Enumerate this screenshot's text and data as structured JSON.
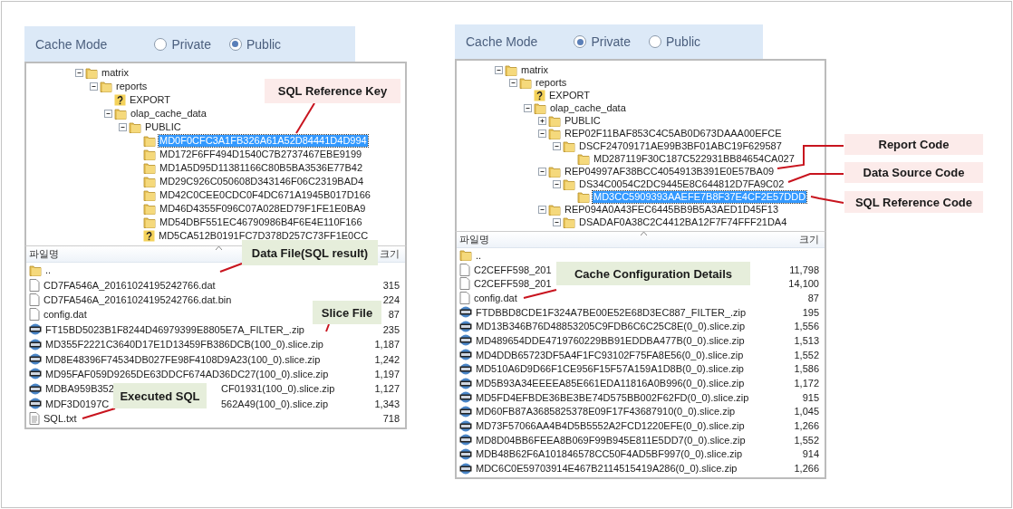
{
  "left_panel": {
    "cache_mode": {
      "label": "Cache Mode",
      "options": [
        {
          "label": "Private",
          "selected": false
        },
        {
          "label": "Public",
          "selected": true
        }
      ]
    },
    "tree": [
      {
        "label": "matrix",
        "kind": "folder",
        "expanded": true,
        "selected": false,
        "children": [
          {
            "label": "reports",
            "kind": "folder",
            "expanded": true,
            "selected": false,
            "children": [
              {
                "label": "EXPORT",
                "kind": "unknown",
                "selected": false
              },
              {
                "label": "olap_cache_data",
                "kind": "folder",
                "expanded": true,
                "selected": false,
                "children": [
                  {
                    "label": "PUBLIC",
                    "kind": "folder",
                    "expanded": true,
                    "selected": false,
                    "children": [
                      {
                        "label": "MD0F0CFC3A1FB326A61A52D84441D4D994",
                        "kind": "folder",
                        "selected": true
                      },
                      {
                        "label": "MD172F6FF494D1540C7B2737467EBE9199",
                        "kind": "folder",
                        "selected": false
                      },
                      {
                        "label": "MD1A5D95D11381166C80B5BA3536E77B42",
                        "kind": "folder",
                        "selected": false
                      },
                      {
                        "label": "MD29C926C050608D343146F06C2319BAD4",
                        "kind": "folder",
                        "selected": false
                      },
                      {
                        "label": "MD42C0CEE0CDC0F4DC671A1945B017D166",
                        "kind": "folder",
                        "selected": false
                      },
                      {
                        "label": "MD46D4355F096C07A028ED79F1FE1E0BA9",
                        "kind": "folder",
                        "selected": false
                      },
                      {
                        "label": "MD54DBF551EC46790986B4F6E4E110F166",
                        "kind": "folder",
                        "selected": false
                      },
                      {
                        "label": "MD5CA512B0191FC7D378D257C73FF1E0CC",
                        "kind": "unknown",
                        "selected": false
                      }
                    ]
                  }
                ]
              }
            ]
          }
        ]
      }
    ],
    "file_list": {
      "columns": [
        "파일명",
        "크기"
      ],
      "rows": [
        {
          "name": "..",
          "kind": "folder"
        },
        {
          "name": "CD7FA546A_20161024195242766.dat",
          "kind": "file",
          "size": "315"
        },
        {
          "name": "CD7FA546A_20161024195242766.dat.bin",
          "kind": "file",
          "size": "224"
        },
        {
          "name": "config.dat",
          "kind": "file",
          "size": "87"
        },
        {
          "name": "FT15BD5023B1F8244D46979399E8805E7A_FILTER_.zip",
          "kind": "zip",
          "size": "235"
        },
        {
          "name": "MD355F2221C3640D17E1D13459FB386DCB(100_0).slice.zip",
          "kind": "zip",
          "size": "1,187"
        },
        {
          "name": "MD8E48396F74534DB027FE98F4108D9A23(100_0).slice.zip",
          "kind": "zip",
          "size": "1,242"
        },
        {
          "name": "MD95FAF059D9265DE63DDCF674AD36DC27(100_0).slice.zip",
          "kind": "zip",
          "size": "1,197"
        },
        {
          "name": "MDBA959B352",
          "tail": "CF01931(100_0).slice.zip",
          "kind": "zip",
          "size": "1,127"
        },
        {
          "name": "MDF3D0197C",
          "tail": "562A49(100_0).slice.zip",
          "kind": "zip",
          "size": "1,343"
        },
        {
          "name": "SQL.txt",
          "kind": "text",
          "size": "718"
        }
      ]
    },
    "callouts": [
      {
        "text": "SQL Reference Key",
        "color": "#fcebea"
      },
      {
        "text": "Data File(SQL result)",
        "color": "#e6eedb"
      },
      {
        "text": "Slice File",
        "color": "#e6eedb"
      },
      {
        "text": "Executed SQL",
        "color": "#e6eedb"
      }
    ]
  },
  "right_panel": {
    "cache_mode": {
      "label": "Cache Mode",
      "options": [
        {
          "label": "Private",
          "selected": true
        },
        {
          "label": "Public",
          "selected": false
        }
      ]
    },
    "tree": [
      {
        "label": "matrix",
        "kind": "folder",
        "expanded": true,
        "selected": false,
        "children": [
          {
            "label": "reports",
            "kind": "folder",
            "expanded": true,
            "selected": false,
            "children": [
              {
                "label": "EXPORT",
                "kind": "unknown",
                "selected": false
              },
              {
                "label": "olap_cache_data",
                "kind": "folder",
                "expanded": true,
                "selected": false,
                "children": [
                  {
                    "label": "PUBLIC",
                    "kind": "folder",
                    "expanded": false,
                    "selected": false
                  },
                  {
                    "label": "REP02F11BAF853C4C5AB0D673DAAA00EFCE",
                    "kind": "folder",
                    "expanded": true,
                    "selected": false,
                    "children": [
                      {
                        "label": "DSCF24709171AE99B3BF01ABC19F629587",
                        "kind": "folder",
                        "expanded": true,
                        "selected": false,
                        "children": [
                          {
                            "label": "MD287119F30C187C522931BB84654CA027",
                            "kind": "folder",
                            "selected": false
                          }
                        ]
                      }
                    ]
                  },
                  {
                    "label": "REP04997AF38BCC4054913B391E0E57BA09",
                    "kind": "folder",
                    "expanded": true,
                    "selected": false,
                    "children": [
                      {
                        "label": "DS34C0054C2DC9445E8C644812D7FA9C02",
                        "kind": "folder",
                        "expanded": true,
                        "selected": false,
                        "children": [
                          {
                            "label": "MD3CC5909393AAEFE7B8F37E4CF2E57DDD",
                            "kind": "folder",
                            "selected": true
                          }
                        ]
                      }
                    ]
                  },
                  {
                    "label": "REP094A0A43FEC6445BB9B5A3AED1D45F13",
                    "kind": "folder",
                    "expanded": true,
                    "selected": false,
                    "children": [
                      {
                        "label": "DSADAF0A38C2C4412BA12F7F74FFF21DA4",
                        "kind": "folder",
                        "expanded": true,
                        "selected": false
                      }
                    ]
                  }
                ]
              }
            ]
          }
        ]
      }
    ],
    "file_list": {
      "columns": [
        "파일명",
        "크기"
      ],
      "rows": [
        {
          "name": "..",
          "kind": "folder"
        },
        {
          "name": "C2CEFF598_201",
          "kind": "file",
          "size": "11,798"
        },
        {
          "name": "C2CEFF598_201",
          "kind": "file",
          "size": "14,100"
        },
        {
          "name": "config.dat",
          "kind": "file",
          "size": "87"
        },
        {
          "name": "FTDBBD8CDE1F324A7BE00E52E68D3EC887_FILTER_.zip",
          "kind": "zip",
          "size": "195"
        },
        {
          "name": "MD13B346B76D48853205C9FDB6C6C25C8E(0_0).slice.zip",
          "kind": "zip",
          "size": "1,556"
        },
        {
          "name": "MD489654DDE4719760229BB91EDDBA477B(0_0).slice.zip",
          "kind": "zip",
          "size": "1,513"
        },
        {
          "name": "MD4DDB65723DF5A4F1FC93102F75FA8E56(0_0).slice.zip",
          "kind": "zip",
          "size": "1,552"
        },
        {
          "name": "MD510A6D9D66F1CE956F15F57A159A1D8B(0_0).slice.zip",
          "kind": "zip",
          "size": "1,586"
        },
        {
          "name": "MD5B93A34EEEEA85E661EDA11816A0B996(0_0).slice.zip",
          "kind": "zip",
          "size": "1,172"
        },
        {
          "name": "MD5FD4EFBDE36BE3BE74D575BB002F62FD(0_0).slice.zip",
          "kind": "zip",
          "size": "915"
        },
        {
          "name": "MD60FB87A3685825378E09F17F43687910(0_0).slice.zip",
          "kind": "zip",
          "size": "1,045"
        },
        {
          "name": "MD73F57066AA4B4D5B5552A2FCD1220EFE(0_0).slice.zip",
          "kind": "zip",
          "size": "1,266"
        },
        {
          "name": "MD8D04BB6FEEA8B069F99B945E811E5DD7(0_0).slice.zip",
          "kind": "zip",
          "size": "1,552"
        },
        {
          "name": "MDB48B62F6A101846578CC50F4AD5BF997(0_0).slice.zip",
          "kind": "zip",
          "size": "914"
        },
        {
          "name": "MDC6C0E59703914E467B2114515419A286(0_0).slice.zip",
          "kind": "zip",
          "size": "1,266"
        }
      ]
    },
    "callouts": [
      {
        "text": "Cache Configuration Details",
        "color": "#e6eedb"
      },
      {
        "text": "Report Code",
        "color": "#fcebea"
      },
      {
        "text": "Data Source Code",
        "color": "#fcebea"
      },
      {
        "text": "SQL Reference Code",
        "color": "#fcebea"
      }
    ]
  }
}
